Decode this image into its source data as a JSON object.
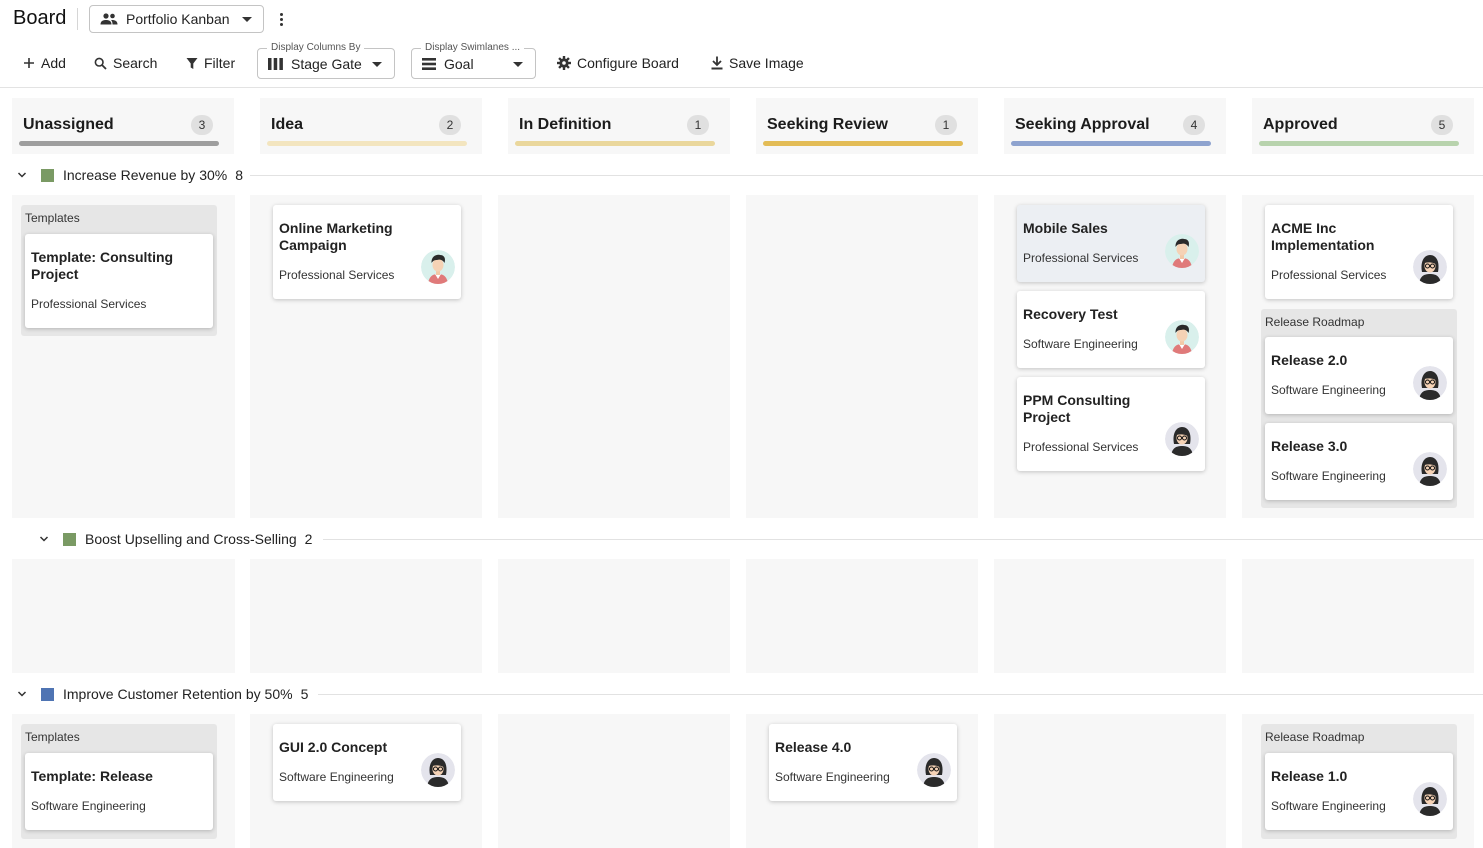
{
  "header": {
    "title": "Board",
    "view_select": "Portfolio Kanban"
  },
  "toolbar": {
    "add": "Add",
    "search": "Search",
    "filter": "Filter",
    "display_columns_legend": "Display Columns By",
    "display_columns_value": "Stage Gate",
    "display_swimlanes_legend": "Display Swimlanes ...",
    "display_swimlanes_value": "Goal",
    "configure_board": "Configure Board",
    "save_image": "Save Image"
  },
  "columns": [
    {
      "name": "Unassigned",
      "count": "3",
      "color": "#9e9e9e"
    },
    {
      "name": "Idea",
      "count": "2",
      "color": "#f3e5bf"
    },
    {
      "name": "In Definition",
      "count": "1",
      "color": "#ead79c"
    },
    {
      "name": "Seeking Review",
      "count": "1",
      "color": "#e3bc56"
    },
    {
      "name": "Seeking Approval",
      "count": "4",
      "color": "#8ea3cf"
    },
    {
      "name": "Approved",
      "count": "5",
      "color": "#b8d3ad"
    }
  ],
  "swimlanes": [
    {
      "name": "Increase Revenue by 30%",
      "count": "8",
      "color": "#7a9a64"
    },
    {
      "name": "Boost Upselling and Cross-Selling",
      "count": "2",
      "color": "#7a9a64"
    },
    {
      "name": "Improve Customer Retention by 50%",
      "count": "5",
      "color": "#4f74b3"
    }
  ],
  "groups": {
    "templates_1": "Templates",
    "release_roadmap_1": "Release Roadmap",
    "templates_2": "Templates",
    "release_roadmap_2": "Release Roadmap"
  },
  "cards": {
    "template_consulting": {
      "title": "Template: Consulting Project",
      "subtitle": "Professional Services"
    },
    "online_marketing": {
      "title": "Online Marketing Campaign",
      "subtitle": "Professional Services"
    },
    "mobile_sales": {
      "title": "Mobile Sales",
      "subtitle": "Professional Services"
    },
    "recovery_test": {
      "title": "Recovery Test",
      "subtitle": "Software Engineering"
    },
    "ppm_consulting": {
      "title": "PPM Consulting Project",
      "subtitle": "Professional Services"
    },
    "acme_impl": {
      "title": "ACME Inc Implementation",
      "subtitle": "Professional Services"
    },
    "release_20": {
      "title": "Release 2.0",
      "subtitle": "Software Engineering"
    },
    "release_30": {
      "title": "Release 3.0",
      "subtitle": "Software Engineering"
    },
    "template_release": {
      "title": "Template: Release",
      "subtitle": "Software Engineering"
    },
    "gui_concept": {
      "title": "GUI 2.0 Concept",
      "subtitle": "Software Engineering"
    },
    "release_40": {
      "title": "Release 4.0",
      "subtitle": "Software Engineering"
    },
    "release_10": {
      "title": "Release 1.0",
      "subtitle": "Software Engineering"
    }
  }
}
